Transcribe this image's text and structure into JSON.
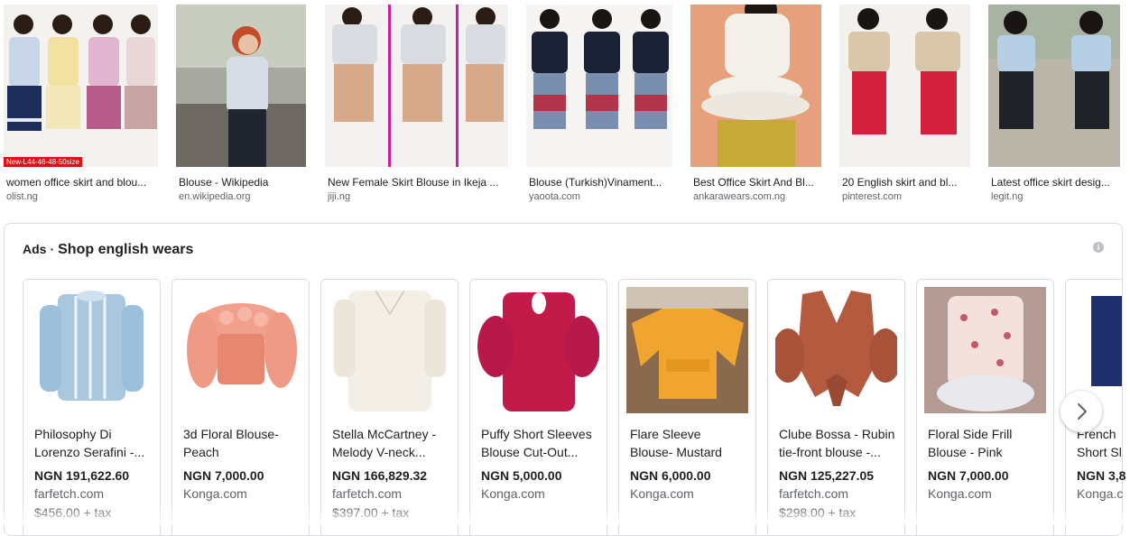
{
  "images": [
    {
      "title": "women office skirt and blou...",
      "source": "olist.ng",
      "badge": "New-L44-46-48-50size"
    },
    {
      "title": "Blouse - Wikipedia",
      "source": "en.wikipedia.org"
    },
    {
      "title": "New Female Skirt Blouse in Ikeja ...",
      "source": "jiji.ng"
    },
    {
      "title": "Blouse (Turkish)Vinament...",
      "source": "yaoota.com"
    },
    {
      "title": "Best Office Skirt And Bl...",
      "source": "ankarawears.com.ng"
    },
    {
      "title": "20 English skirt and bl...",
      "source": "pinterest.com"
    },
    {
      "title": "Latest office skirt desig...",
      "source": "legit.ng"
    }
  ],
  "ads": {
    "label": "Ads",
    "separator": "·",
    "title": "Shop english wears",
    "info_icon": "i",
    "products": [
      {
        "title1": "Philosophy Di",
        "title2": "Lorenzo Serafini -...",
        "price": "NGN 191,622.60",
        "store": "farfetch.com",
        "extra": "$456.00 + tax"
      },
      {
        "title1": "3d Floral Blouse-",
        "title2": "Peach",
        "price": "NGN 7,000.00",
        "store": "Konga.com",
        "extra": ""
      },
      {
        "title1": "Stella McCartney -",
        "title2": "Melody V-neck...",
        "price": "NGN 166,829.32",
        "store": "farfetch.com",
        "extra": "$397.00 + tax"
      },
      {
        "title1": "Puffy Short Sleeves",
        "title2": "Blouse Cut-Out...",
        "price": "NGN 5,000.00",
        "store": "Konga.com",
        "extra": ""
      },
      {
        "title1": "Flare Sleeve",
        "title2": "Blouse- Mustard",
        "price": "NGN 6,000.00",
        "store": "Konga.com",
        "extra": ""
      },
      {
        "title1": "Clube Bossa - Rubin",
        "title2": "tie-front blouse -...",
        "price": "NGN 125,227.05",
        "store": "farfetch.com",
        "extra": "$298.00 + tax"
      },
      {
        "title1": "Floral Side Frill",
        "title2": "Blouse - Pink",
        "price": "NGN 7,000.00",
        "store": "Konga.com",
        "extra": ""
      },
      {
        "title1": "French",
        "title2": "Short Sl",
        "price": "NGN 3,8",
        "store": "Konga.c",
        "extra": ""
      }
    ]
  },
  "colors": {
    "text": "#202124",
    "muted": "#5f6368",
    "border": "#dadce0"
  },
  "icons": {
    "next": "chevron-right-icon",
    "info": "info-icon"
  }
}
